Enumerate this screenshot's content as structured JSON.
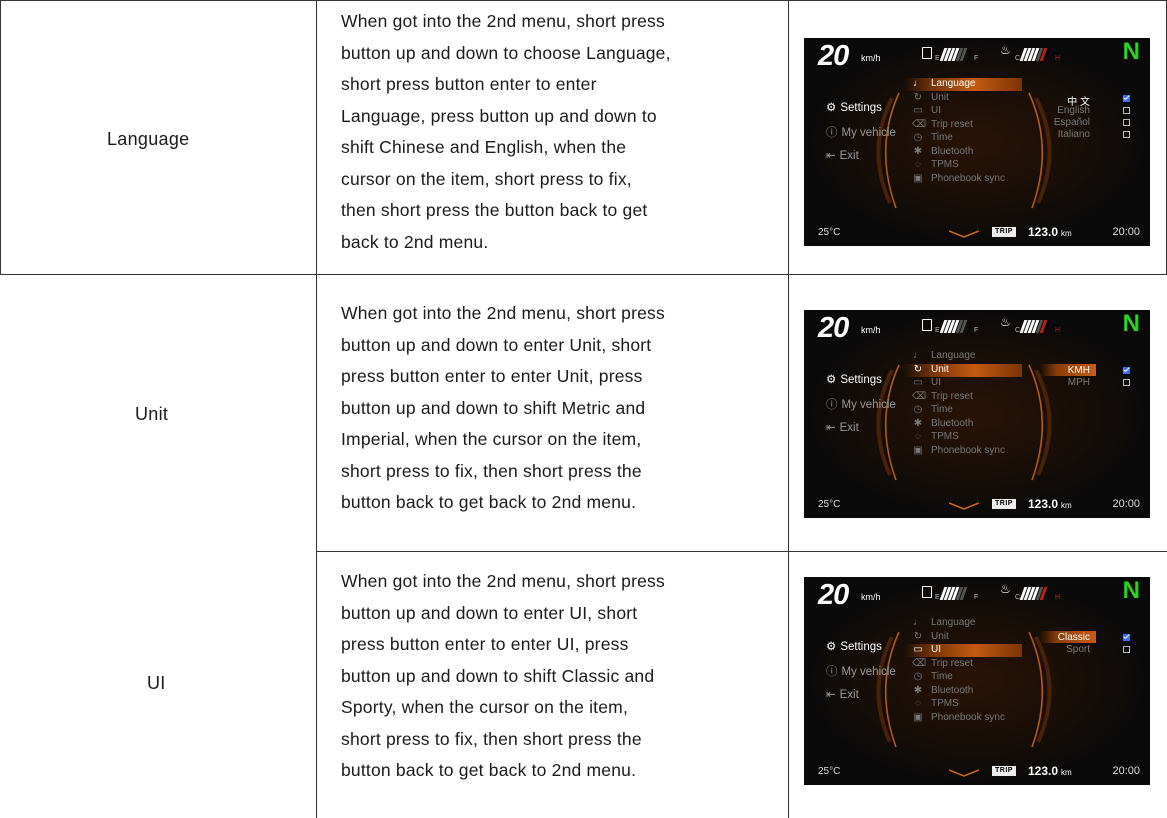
{
  "rows": [
    {
      "label": "Language",
      "description": [
        "When got into the 2nd menu, short press",
        "button up and down to choose Language,",
        "short press button enter to enter",
        "Language, press button up and down to",
        "shift Chinese and English, when the",
        "cursor on the item, short press to fix,",
        "then short press the button back to get",
        "back to 2nd menu."
      ],
      "screen": {
        "speed": "20",
        "speed_unit": "km/h",
        "gear": "N",
        "selected_index": 0,
        "options": [
          {
            "label": "中  文",
            "checked": true
          },
          {
            "label": "English",
            "checked": false
          },
          {
            "label": "Español",
            "checked": false
          },
          {
            "label": "Italiano",
            "checked": false
          }
        ],
        "option_highlight": false
      }
    },
    {
      "label": "Unit",
      "description": [
        "When got into the 2nd menu, short press",
        "button up and down to enter Unit, short",
        "press button enter to enter Unit, press",
        "button up and down to shift Metric and",
        "Imperial, when the cursor on the item,",
        "short press to fix, then short press the",
        "button back to get back to 2nd menu."
      ],
      "screen": {
        "speed": "20",
        "speed_unit": "km/h",
        "gear": "N",
        "selected_index": 1,
        "options": [
          {
            "label": "KMH",
            "checked": true
          },
          {
            "label": "MPH",
            "checked": false
          }
        ],
        "option_highlight": true
      }
    },
    {
      "label": "UI",
      "description": [
        "When got into the 2nd menu, short press",
        "button up and down to enter UI, short",
        "press button enter to enter UI, press",
        "button up and down to shift Classic and",
        "Sporty, when the cursor on the item,",
        "short press to fix, then short press the",
        "button back to get back to 2nd menu."
      ],
      "screen": {
        "speed": "20",
        "speed_unit": "km/h",
        "gear": "N",
        "selected_index": 2,
        "options": [
          {
            "label": "Classic",
            "checked": true
          },
          {
            "label": "Sport",
            "checked": false
          }
        ],
        "option_highlight": true
      }
    }
  ],
  "dashboard": {
    "left_menu": [
      "Settings",
      "My vehicle",
      "Exit"
    ],
    "submenu": [
      {
        "label": "Language",
        "icon": "microphone-icon"
      },
      {
        "label": "Unit",
        "icon": "refresh-icon"
      },
      {
        "label": "UI",
        "icon": "window-icon"
      },
      {
        "label": "Trip reset",
        "icon": "trash-icon"
      },
      {
        "label": "Time",
        "icon": "clock-icon"
      },
      {
        "label": "Bluetooth",
        "icon": "bluetooth-icon"
      },
      {
        "label": "TPMS",
        "icon": "tire-pressure-icon"
      },
      {
        "label": "Phonebook sync",
        "icon": "contacts-icon"
      }
    ],
    "fuel_empty": "E",
    "fuel_full": "F",
    "temp_cold": "C",
    "temp_hot": "H",
    "ambient_temp": "25°C",
    "trip_badge": "TRIP",
    "trip_value": "123.0",
    "trip_unit": "km",
    "clock": "20:00",
    "colors": {
      "gear": "#2ad41f",
      "accent": "#c35a10",
      "checkbox": "#3b6bff"
    }
  }
}
